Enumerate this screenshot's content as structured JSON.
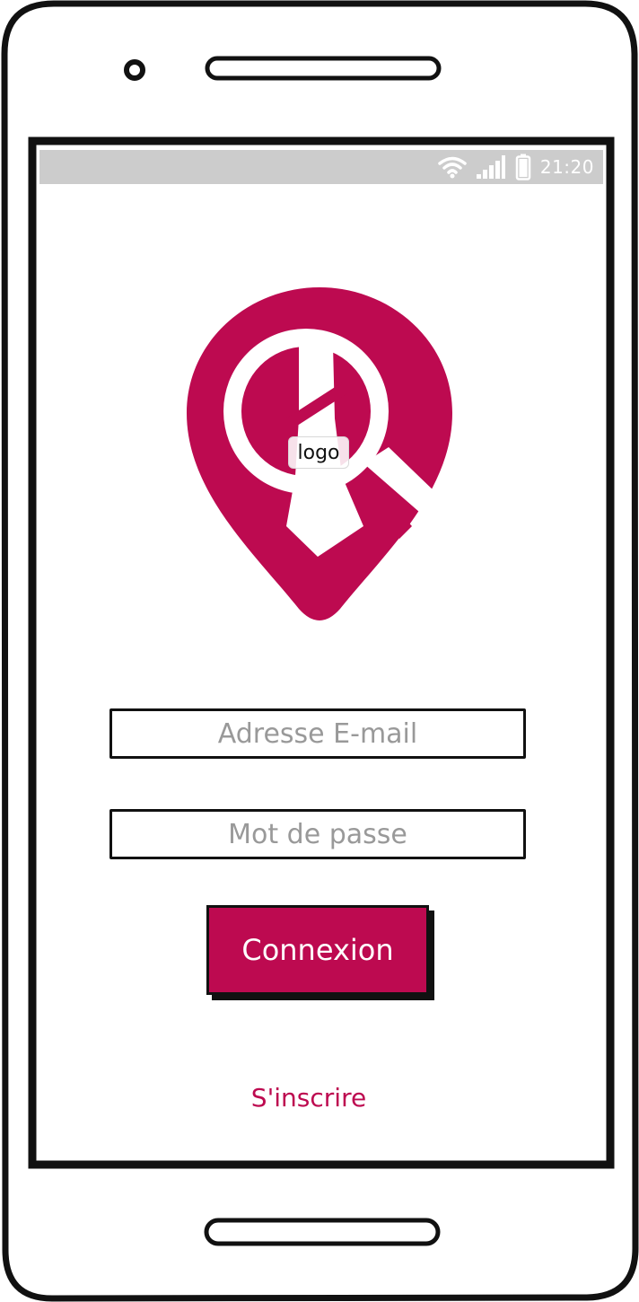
{
  "status_bar": {
    "time": "21:20",
    "icons": [
      "wifi-icon",
      "signal-icon",
      "battery-icon"
    ]
  },
  "logo": {
    "label": "logo"
  },
  "login_form": {
    "email_placeholder": "Adresse E-mail",
    "password_placeholder": "Mot de passe",
    "submit_label": "Connexion",
    "signup_label": "S'inscrire"
  },
  "colors": {
    "accent": "#bd0a50",
    "status_bar_bg": "#cccccc",
    "placeholder_text": "#999999",
    "frame": "#111111"
  }
}
